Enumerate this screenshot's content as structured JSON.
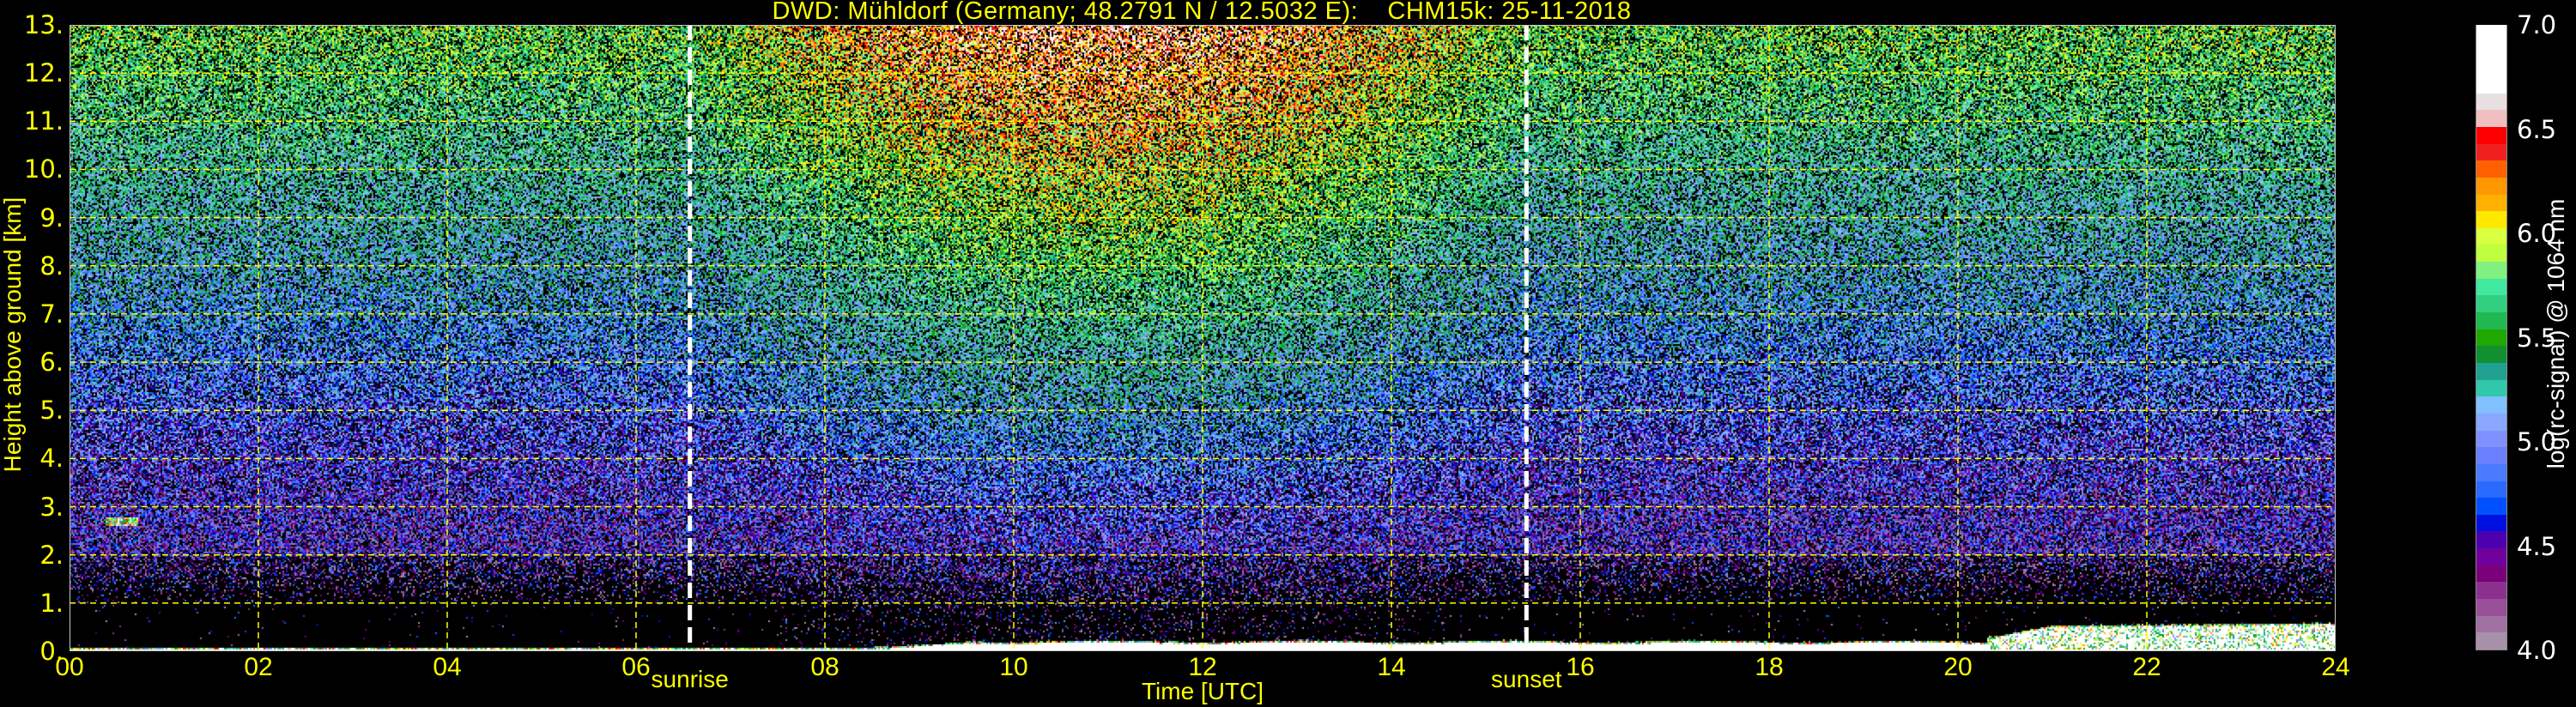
{
  "chart_data": {
    "type": "heatmap",
    "title": "DWD: Mühldorf (Germany; 48.2791 N / 12.5032 E):    CHM15k: 25-11-2018",
    "xlabel": "Time [UTC]",
    "ylabel": "Height above ground [km]",
    "xlim": [
      0,
      24
    ],
    "ylim": [
      0,
      13
    ],
    "xticks": [
      "00",
      "02",
      "04",
      "06",
      "08",
      "10",
      "12",
      "14",
      "16",
      "18",
      "20",
      "22",
      "24"
    ],
    "xtick_values": [
      0,
      2,
      4,
      6,
      8,
      10,
      12,
      14,
      16,
      18,
      20,
      22,
      24
    ],
    "yticks": [
      "0.",
      "1.",
      "2.",
      "3.",
      "4.",
      "5.",
      "6.",
      "7.",
      "8.",
      "9.",
      "10.",
      "11.",
      "12.",
      "13."
    ],
    "ytick_values": [
      0,
      1,
      2,
      3,
      4,
      5,
      6,
      7,
      8,
      9,
      10,
      11,
      12,
      13
    ],
    "grid": true,
    "grid_color": "#ffff00",
    "background": "#000000",
    "annotations": [
      {
        "label": "sunrise",
        "x": 6.57
      },
      {
        "label": "sunset",
        "x": 15.43
      }
    ],
    "colorbar": {
      "label": "log(rc-signal) @ 1064 nm",
      "range": [
        4.0,
        7.0
      ],
      "ticks": [
        "4.0",
        "4.5",
        "5.0",
        "5.5",
        "6.0",
        "6.5",
        "7.0"
      ],
      "tick_values": [
        4.0,
        4.5,
        5.0,
        5.5,
        6.0,
        6.5,
        7.0
      ],
      "position": "right",
      "colors": [
        "#a890a8",
        "#a070a0",
        "#985098",
        "#8c3090",
        "#7a007a",
        "#70009c",
        "#4c00b0",
        "#0010e0",
        "#0050ff",
        "#2a6aff",
        "#4a7aff",
        "#6a80ff",
        "#8090ff",
        "#8aa8ff",
        "#80c0ff",
        "#30c8a8",
        "#20a090",
        "#109030",
        "#20a800",
        "#20b850",
        "#30d080",
        "#40e8a0",
        "#80f080",
        "#c0ff40",
        "#d8ff40",
        "#ffe800",
        "#ffb000",
        "#ff9800",
        "#ff6000",
        "#f02020",
        "#ff0000",
        "#f0c0c0",
        "#e8e0e0",
        "#ffffff",
        "#ffffff",
        "#ffffff",
        "#ffffff"
      ]
    }
  }
}
